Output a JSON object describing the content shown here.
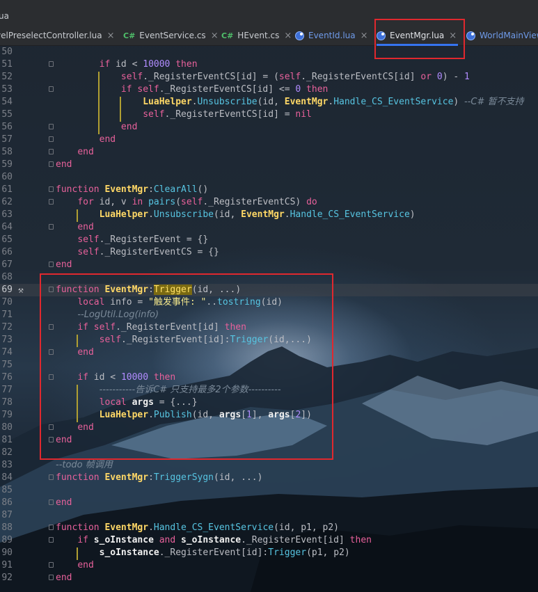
{
  "window": {
    "file_path_fragment": "ua"
  },
  "tabs": [
    {
      "label": "velPreselectController.lua",
      "type": "lua",
      "active": false,
      "close": true
    },
    {
      "label": "EventService.cs",
      "type": "cs",
      "active": false,
      "close": true
    },
    {
      "label": "HEvent.cs",
      "type": "cs",
      "active": false,
      "close": true
    },
    {
      "label": "EventId.lua",
      "type": "lua",
      "active": false,
      "close": true
    },
    {
      "label": "EventMgr.lua",
      "type": "lua",
      "active": true,
      "close": true
    },
    {
      "label": "WorldMainView",
      "type": "lua",
      "active": false,
      "close": false
    }
  ],
  "tab_icons": {
    "cs": "C#",
    "close": "×"
  },
  "editor": {
    "current_line": 69,
    "lines": [
      {
        "n": 50,
        "text": "            "
      },
      {
        "n": 51,
        "text": "        if id < 10000 then"
      },
      {
        "n": 52,
        "text": "            self._RegisterEventCS[id] = (self._RegisterEventCS[id] or 0) - 1"
      },
      {
        "n": 53,
        "text": "            if self._RegisterEventCS[id] <= 0 then"
      },
      {
        "n": 54,
        "text": "                LuaHelper.Unsubscribe(id, EventMgr.Handle_CS_EventService) --C# 暂不支持"
      },
      {
        "n": 55,
        "text": "                self._RegisterEventCS[id] = nil"
      },
      {
        "n": 56,
        "text": "            end"
      },
      {
        "n": 57,
        "text": "        end"
      },
      {
        "n": 58,
        "text": "    end"
      },
      {
        "n": 59,
        "text": "end"
      },
      {
        "n": 60,
        "text": ""
      },
      {
        "n": 61,
        "text": "function EventMgr:ClearAll()"
      },
      {
        "n": 62,
        "text": "    for id, v in pairs(self._RegisterEventCS) do"
      },
      {
        "n": 63,
        "text": "        LuaHelper.Unsubscribe(id, EventMgr.Handle_CS_EventService)"
      },
      {
        "n": 64,
        "text": "    end"
      },
      {
        "n": 65,
        "text": "    self._RegisterEvent = {}"
      },
      {
        "n": 66,
        "text": "    self._RegisterEventCS = {}"
      },
      {
        "n": 67,
        "text": "end"
      },
      {
        "n": 68,
        "text": ""
      },
      {
        "n": 69,
        "text": "function EventMgr:Trigger(id, ...)"
      },
      {
        "n": 70,
        "text": "    local info = \"触发事件: \"..tostring(id)"
      },
      {
        "n": 71,
        "text": "    --LogUtil.Log(info)"
      },
      {
        "n": 72,
        "text": "    if self._RegisterEvent[id] then"
      },
      {
        "n": 73,
        "text": "        self._RegisterEvent[id]:Trigger(id,...)"
      },
      {
        "n": 74,
        "text": "    end"
      },
      {
        "n": 75,
        "text": ""
      },
      {
        "n": 76,
        "text": "    if id < 10000 then"
      },
      {
        "n": 77,
        "text": "        -----------告诉C# 只支持最多2个参数----------"
      },
      {
        "n": 78,
        "text": "        local args = {...}"
      },
      {
        "n": 79,
        "text": "        LuaHelper.Publish(id, args[1], args[2])"
      },
      {
        "n": 80,
        "text": "    end"
      },
      {
        "n": 81,
        "text": "end"
      },
      {
        "n": 82,
        "text": ""
      },
      {
        "n": 83,
        "text": "--todo 帧调用"
      },
      {
        "n": 84,
        "text": "function EventMgr:TriggerSygn(id, ...)"
      },
      {
        "n": 85,
        "text": ""
      },
      {
        "n": 86,
        "text": "end"
      },
      {
        "n": 87,
        "text": ""
      },
      {
        "n": 88,
        "text": "function EventMgr.Handle_CS_EventService(id, p1, p2)"
      },
      {
        "n": 89,
        "text": "    if s_oInstance and s_oInstance._RegisterEvent[id] then"
      },
      {
        "n": 90,
        "text": "        s_oInstance._RegisterEvent[id]:Trigger(p1, p2)"
      },
      {
        "n": 91,
        "text": "    end"
      },
      {
        "n": 92,
        "text": "end"
      }
    ]
  },
  "colors": {
    "keyword": "#e8619b",
    "function": "#57c5e2",
    "class": "#ffd866",
    "number": "#b18cff",
    "string": "#f4e88c",
    "comment": "#7b8a99",
    "annotation_box": "#e0282e",
    "active_tab_underline": "#3574f0"
  },
  "icons": {
    "gutter_line_69": "hammer-icon",
    "lua_tab": "lua-file-icon",
    "cs_tab": "csharp-file-icon"
  }
}
